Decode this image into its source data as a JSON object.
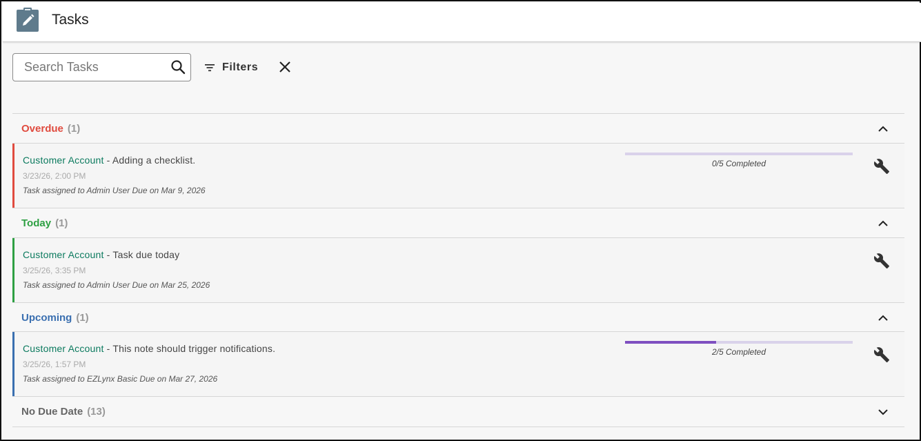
{
  "header": {
    "title": "Tasks",
    "icon": "clipboard-edit-icon"
  },
  "toolbar": {
    "search_placeholder": "Search Tasks",
    "search_icon": "search-icon",
    "filters_label": "Filters",
    "filters_icon": "filter-list-icon",
    "clear_icon": "close-icon"
  },
  "colors": {
    "overdue": "#e04b3f",
    "today": "#2ea043",
    "upcoming": "#3a6fb0",
    "no_due": "#666666",
    "account_link": "#0b7a5e",
    "progress_fill": "#7e4fc0",
    "progress_track": "#d9d2ea"
  },
  "sections": [
    {
      "label": "Overdue",
      "count": "(1)",
      "expanded": true,
      "tasks": [
        {
          "account": "Customer Account",
          "title": " - Adding a checklist.",
          "date": "3/23/26, 2:00 PM",
          "assignment": "Task assigned to Admin User Due on Mar 9, 2026",
          "progress_text": "0/5 Completed",
          "progress_fraction": 0.0
        }
      ]
    },
    {
      "label": "Today",
      "count": "(1)",
      "expanded": true,
      "tasks": [
        {
          "account": "Customer Account",
          "title": " - Task due today",
          "date": "3/25/26, 3:35 PM",
          "assignment": "Task assigned to Admin User Due on Mar 25, 2026"
        }
      ]
    },
    {
      "label": "Upcoming",
      "count": "(1)",
      "expanded": true,
      "tasks": [
        {
          "account": "Customer Account",
          "title": " - This note should trigger notifications.",
          "date": "3/25/26, 1:57 PM",
          "assignment": "Task assigned to EZLynx Basic Due on Mar 27, 2026",
          "progress_text": "2/5 Completed",
          "progress_fraction": 0.4
        }
      ]
    },
    {
      "label": "No Due Date",
      "count": "(13)",
      "expanded": false,
      "tasks": []
    }
  ]
}
